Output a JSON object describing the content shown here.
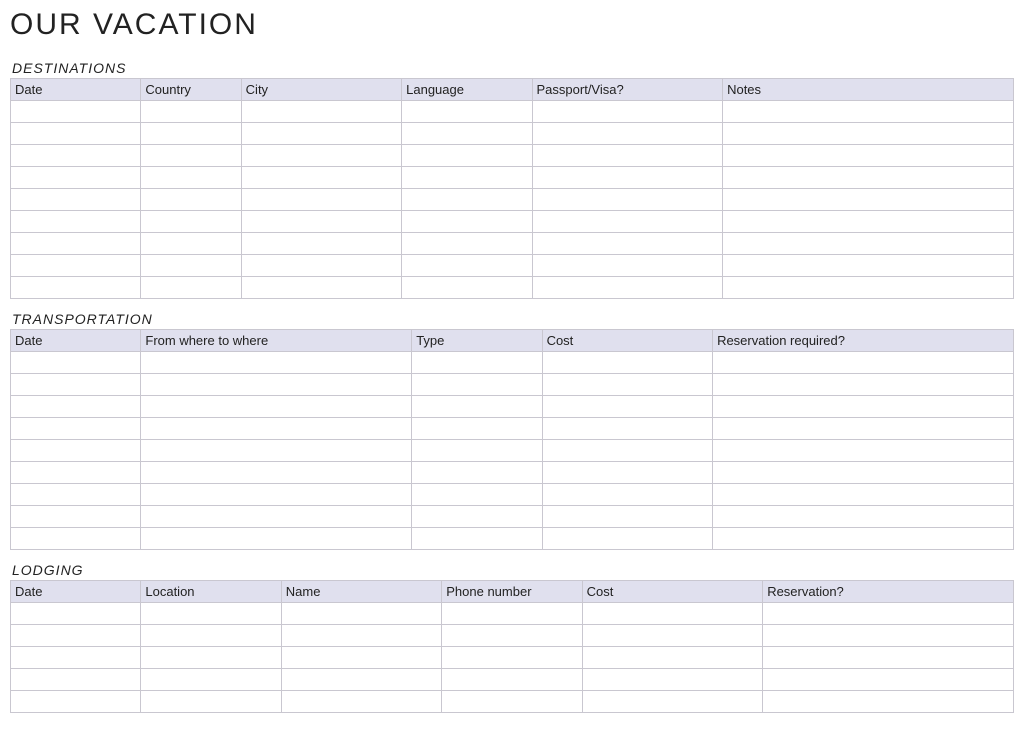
{
  "title": "OUR VACATION",
  "sections": {
    "destinations": {
      "heading": "DESTINATIONS",
      "columns": [
        "Date",
        "Country",
        "City",
        "Language",
        "Passport/Visa?",
        "Notes"
      ],
      "widths": [
        "13%",
        "10%",
        "16%",
        "13%",
        "19%",
        "29%"
      ],
      "rowCount": 9
    },
    "transportation": {
      "heading": "TRANSPORTATION",
      "columns": [
        "Date",
        "From where to where",
        "Type",
        "Cost",
        "Reservation required?"
      ],
      "widths": [
        "13%",
        "27%",
        "13%",
        "17%",
        "30%"
      ],
      "rowCount": 9
    },
    "lodging": {
      "heading": "LODGING",
      "columns": [
        "Date",
        "Location",
        "Name",
        "Phone number",
        "Cost",
        "Reservation?"
      ],
      "widths": [
        "13%",
        "14%",
        "16%",
        "14%",
        "18%",
        "25%"
      ],
      "rowCount": 5
    }
  }
}
